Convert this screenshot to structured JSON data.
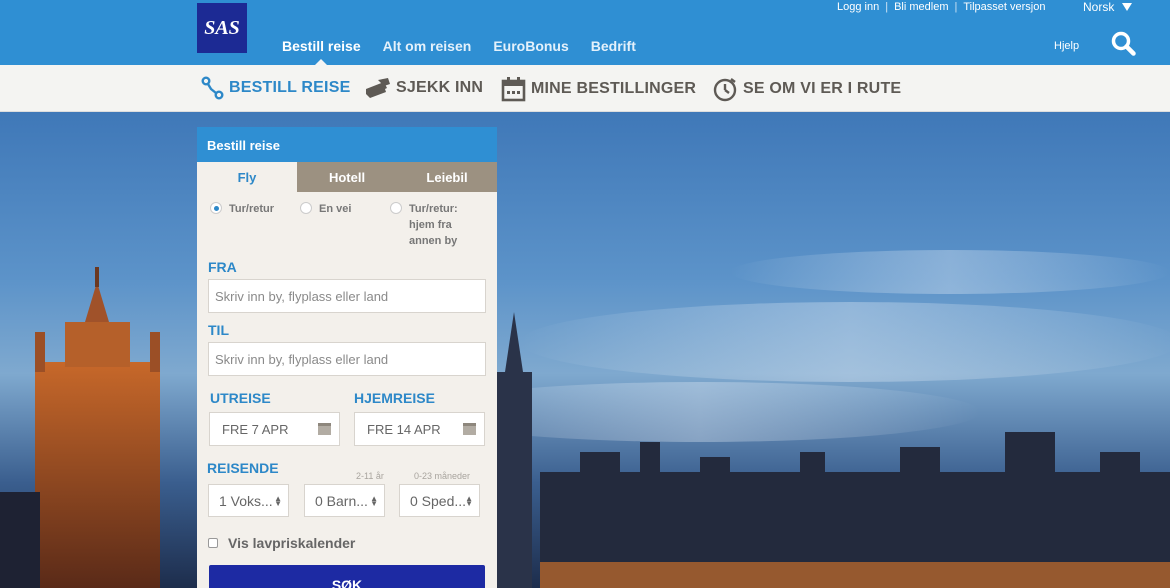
{
  "header": {
    "logo_text": "SAS",
    "nav": [
      {
        "label": "Bestill reise",
        "active": true
      },
      {
        "label": "Alt om reisen"
      },
      {
        "label": "EuroBonus"
      },
      {
        "label": "Bedrift"
      }
    ],
    "top_links": [
      "Logg inn",
      "Bli medlem",
      "Tilpasset versjon"
    ],
    "language": "Norsk",
    "help": "Hjelp",
    "search_icon": "search-icon"
  },
  "subnav": {
    "items": [
      {
        "label": "BESTILL REISE",
        "icon": "route-icon",
        "active": true
      },
      {
        "label": "SJEKK INN",
        "icon": "ticket-icon"
      },
      {
        "label": "MINE BESTILLINGER",
        "icon": "calendar-icon"
      },
      {
        "label": "SE OM VI ER I RUTE",
        "icon": "stopwatch-icon"
      }
    ]
  },
  "booking": {
    "title": "Bestill reise",
    "tabs": [
      "Fly",
      "Hotell",
      "Leiebil"
    ],
    "trip_types": [
      "Tur/retur",
      "En vei",
      "Tur/retur: hjem fra annen by"
    ],
    "from_label": "FRA",
    "from_placeholder": "Skriv inn by, flyplass eller land",
    "to_label": "TIL",
    "to_placeholder": "Skriv inn by, flyplass eller land",
    "depart_label": "UTREISE",
    "depart_value": "FRE 7 APR",
    "return_label": "HJEMREISE",
    "return_value": "FRE 14 APR",
    "travelers_label": "REISENDE",
    "children_hint": "2-11 år",
    "infant_hint": "0-23 måneder",
    "adults": "1 Voks...",
    "children": "0 Barn...",
    "infants": "0 Sped...",
    "lowfare_label": "Vis lavpriskalender",
    "search_button": "SØK"
  },
  "colors": {
    "brand_blue": "#2f8fd3",
    "logo_navy": "#1c2a94",
    "button_navy": "#1d2aa3",
    "tab_brown": "#9c9181"
  }
}
